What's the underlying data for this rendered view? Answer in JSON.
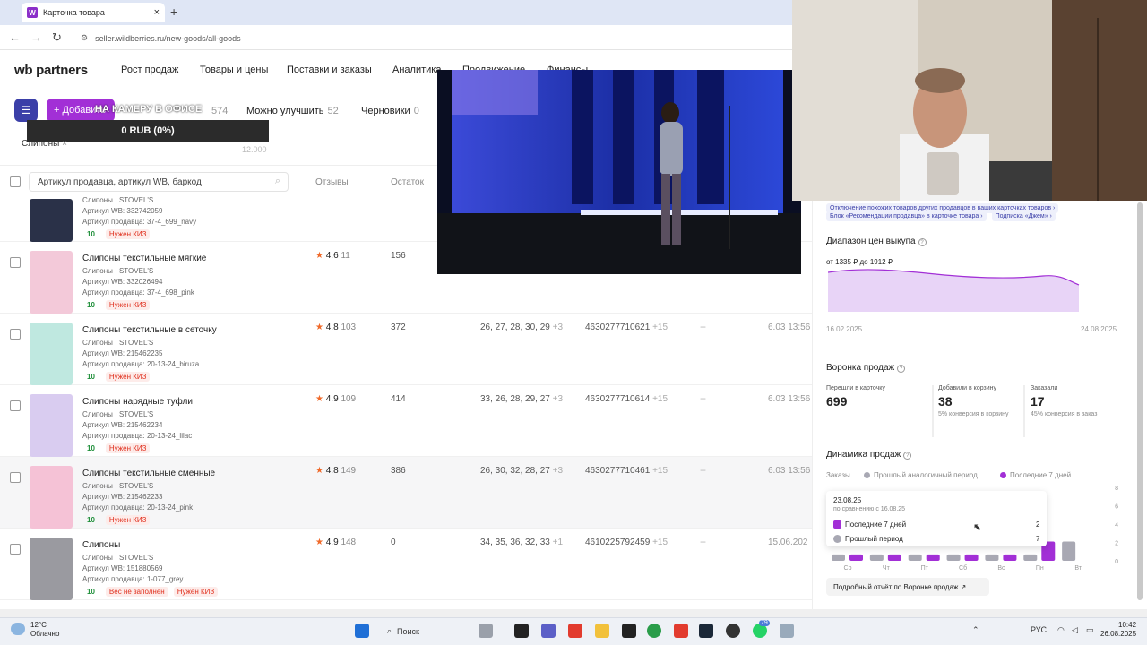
{
  "browser": {
    "tab_title": "Карточка товара",
    "tab_favicon": "W",
    "tab_close": "×",
    "new_tab": "+",
    "back": "←",
    "forward": "→",
    "reload": "↻",
    "url": "seller.wildberries.ru/new-goods/all-goods"
  },
  "header": {
    "logo_wb": "wb",
    "logo_partners": "partners",
    "nav": [
      "Рост продаж",
      "Товары и цены",
      "Поставки и заказы",
      "Аналитика",
      "Продвижение",
      "Финансы"
    ]
  },
  "toolbar": {
    "add_label": "+ Добавить",
    "overlay_text": "НА КАМЕРУ В ОФИСЕ",
    "all_count": "574",
    "can_improve_label": "Можно улучшить",
    "can_improve_count": "52",
    "drafts_label": "Черновики",
    "drafts_count": "0",
    "rub_text": "0 RUB (0%)",
    "side_number": "12.000",
    "chip_label": "Слипоны",
    "chip_close": "×"
  },
  "table": {
    "search_placeholder": "Артикул продавца, артикул WB, баркод",
    "columns": [
      "Отзывы",
      "Остаток"
    ],
    "rows": [
      {
        "name": "Слипоны · STOVEL'S",
        "wb": "Артикул WB: 332742059",
        "seller": "Артикул продавца: 37-4_699_navy",
        "qty": "10",
        "badge": "Нужен КИЗ",
        "rating": "",
        "reviews": "",
        "stock": "",
        "sizes": "",
        "sizes_more": "",
        "barcode": "",
        "barcode_more": "",
        "date": ""
      },
      {
        "name": "Слипоны текстильные мягкие",
        "brand": "Слипоны · STOVEL'S",
        "wb": "Артикул WB: 332026494",
        "seller": "Артикул продавца: 37-4_698_pink",
        "qty": "10",
        "badge": "Нужен КИЗ",
        "rating": "4.6",
        "reviews": "11",
        "stock": "156",
        "sizes": "",
        "sizes_more": "",
        "barcode": "",
        "barcode_more": "",
        "date": ""
      },
      {
        "name": "Слипоны текстильные в сеточку",
        "brand": "Слипоны · STOVEL'S",
        "wb": "Артикул WB: 215462235",
        "seller": "Артикул продавца: 20-13-24_biruza",
        "qty": "10",
        "badge": "Нужен КИЗ",
        "rating": "4.8",
        "reviews": "103",
        "stock": "372",
        "sizes": "26, 27, 28, 30, 29",
        "sizes_more": "+3",
        "barcode": "4630277710621",
        "barcode_more": "+15",
        "date": "6.03 13:56"
      },
      {
        "name": "Слипоны нарядные туфли",
        "brand": "Слипоны · STOVEL'S",
        "wb": "Артикул WB: 215462234",
        "seller": "Артикул продавца: 20-13-24_lilac",
        "qty": "10",
        "badge": "Нужен КИЗ",
        "rating": "4.9",
        "reviews": "109",
        "stock": "414",
        "sizes": "33, 26, 28, 29, 27",
        "sizes_more": "+3",
        "barcode": "4630277710614",
        "barcode_more": "+15",
        "date": "6.03 13:56"
      },
      {
        "name": "Слипоны текстильные сменные",
        "brand": "Слипоны · STOVEL'S",
        "wb": "Артикул WB: 215462233",
        "seller": "Артикул продавца: 20-13-24_pink",
        "qty": "10",
        "badge": "Нужен КИЗ",
        "rating": "4.8",
        "reviews": "149",
        "stock": "386",
        "sizes": "26, 30, 32, 28, 27",
        "sizes_more": "+3",
        "barcode": "4630277710461",
        "barcode_more": "+15",
        "date": "6.03 13:56"
      },
      {
        "name": "Слипоны",
        "brand": "Слипоны · STOVEL'S",
        "wb": "Артикул WB: 151880569",
        "seller": "Артикул продавца: 1-077_grey",
        "qty": "10",
        "badge2": "Вес не заполнен",
        "badge": "Нужен КИЗ",
        "rating": "4.9",
        "reviews": "148",
        "stock": "0",
        "sizes": "34, 35, 36, 32, 33",
        "sizes_more": "+1",
        "barcode": "4610225792459",
        "barcode_more": "+15",
        "date": "15.06.202"
      }
    ]
  },
  "panel": {
    "link1": "Отключение похожих товаров других продавцов в ваших карточках товаров ›",
    "link2": "Блок «Рекомендации продавца» в карточке товара ›",
    "link3": "Подписка «Джем» ›",
    "price_title": "Диапазон цен выкупа",
    "price_range": "от 1335 ₽ до 1912 ₽",
    "date_from": "16.02.2025",
    "date_to": "24.08.2025",
    "funnel_title": "Воронка продаж",
    "funnel": [
      {
        "label": "Перешли в карточку",
        "value": "699",
        "note": ""
      },
      {
        "label": "Добавили в корзину",
        "value": "38",
        "note": "5% конверсия в корзину"
      },
      {
        "label": "Заказали",
        "value": "17",
        "note": "45% конверсия в заказ"
      }
    ],
    "dynamics_title": "Динамика продаж",
    "orders_label": "Заказы",
    "legend_prev": "Прошлый аналогичный период",
    "legend_last": "Последние 7 дней",
    "tooltip_date": "23.08.25",
    "tooltip_compare": "по сравнению с 16.08.25",
    "tooltip_last_label": "Последние 7 дней",
    "tooltip_last_value": "2",
    "tooltip_prev_label": "Прошлый период",
    "tooltip_prev_value": "7",
    "y_ticks": [
      "8",
      "6",
      "4",
      "2",
      "0"
    ],
    "days": [
      "Ср",
      "Чт",
      "Пт",
      "Сб",
      "Вс",
      "Пн",
      "Вт"
    ],
    "detail_button": "Подробный отчёт по Воронке продаж ↗",
    "colors": {
      "purple": "#a22fd6",
      "grey": "#a8a8b3"
    }
  },
  "chart_data": {
    "type": "bar",
    "categories": [
      "Ср",
      "Чт",
      "Пт",
      "Сб",
      "Вс",
      "Пн",
      "Вт"
    ],
    "series": [
      {
        "name": "Прошлый аналогичный период",
        "values": [
          0.5,
          0.5,
          0.5,
          0.5,
          0.5,
          0.5,
          1.5
        ]
      },
      {
        "name": "Последние 7 дней",
        "values": [
          0.5,
          0.5,
          0.5,
          0.5,
          0.5,
          1.5,
          0
        ]
      }
    ],
    "ylim": [
      0,
      8
    ]
  },
  "taskbar": {
    "weather_temp": "12°C",
    "weather_desc": "Облачно",
    "search": "Поиск",
    "lang": "РУС",
    "time": "10:42",
    "date": "26.08.2025",
    "badge_count": "79"
  }
}
